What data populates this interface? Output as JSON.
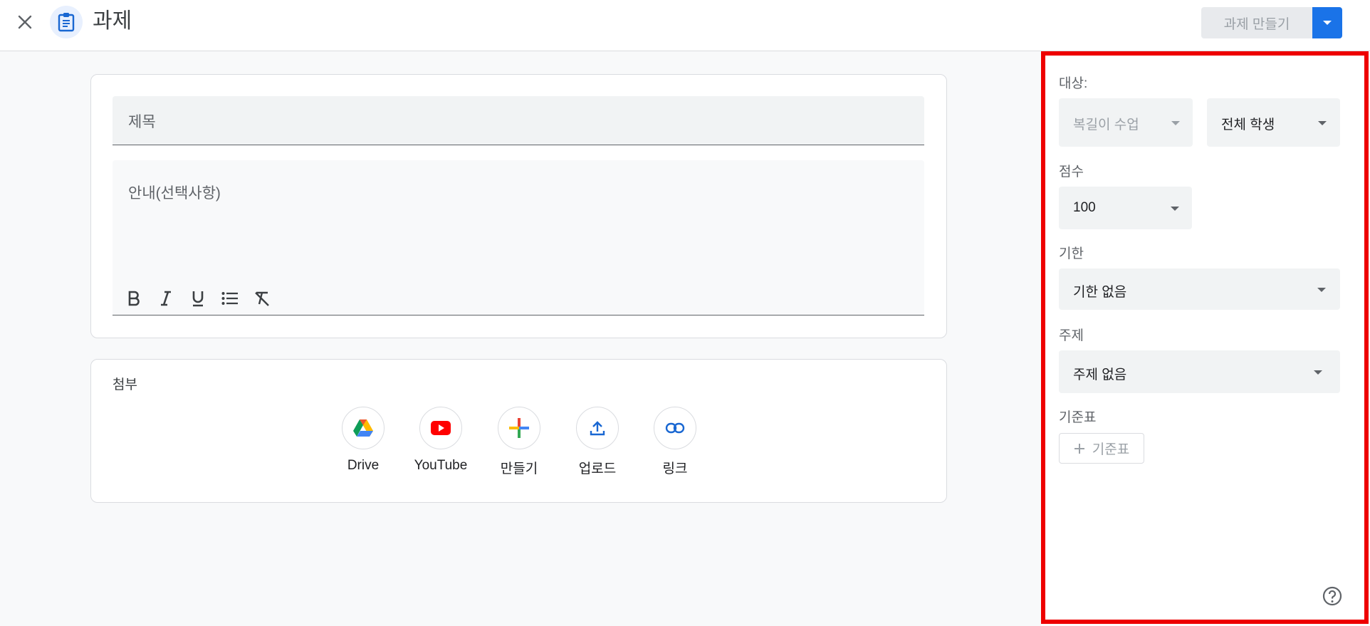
{
  "header": {
    "title": "과제",
    "create_label": "과제 만들기"
  },
  "form": {
    "title_placeholder": "제목",
    "description_placeholder": "안내(선택사항)",
    "format_tools": [
      "bold-icon",
      "italic-icon",
      "underline-icon",
      "bulleted-list-icon",
      "clear-format-icon"
    ]
  },
  "attachments": {
    "label": "첨부",
    "items": [
      {
        "label": "Drive",
        "icon": "drive-icon"
      },
      {
        "label": "YouTube",
        "icon": "youtube-icon"
      },
      {
        "label": "만들기",
        "icon": "create-plus-icon"
      },
      {
        "label": "업로드",
        "icon": "upload-icon"
      },
      {
        "label": "링크",
        "icon": "link-icon"
      }
    ]
  },
  "sidebar": {
    "for_label": "대상:",
    "class_value": "복길이 수업",
    "students_value": "전체 학생",
    "points_label": "점수",
    "points_value": "100",
    "due_label": "기한",
    "due_value": "기한 없음",
    "topic_label": "주제",
    "topic_value": "주제 없음",
    "rubric_label": "기준표",
    "rubric_button": "기준표"
  },
  "colors": {
    "accent": "#1a73e8",
    "highlight_outline": "#ee0000",
    "youtube_red": "#ff0000"
  }
}
